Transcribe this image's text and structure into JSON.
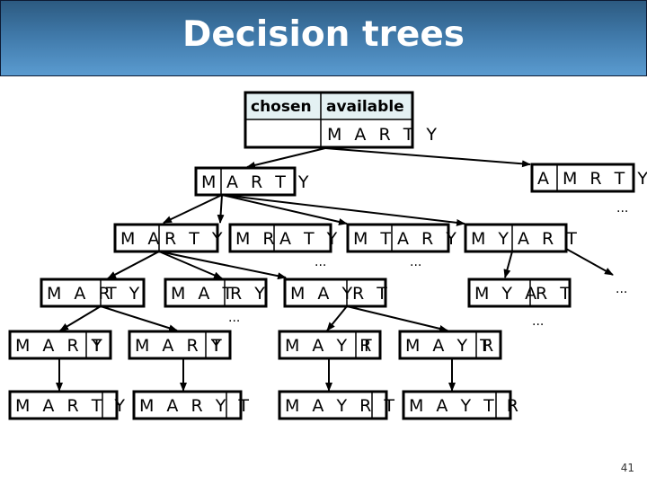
{
  "slide": {
    "title": "Decision trees",
    "page_number": "41"
  },
  "root_table": {
    "headers": [
      "chosen",
      "available"
    ],
    "chosen": "",
    "available": "M A R T Y"
  },
  "ellipsis": "...",
  "nodes": [
    {
      "id": "l1-m",
      "chosen": "M",
      "available": "A R T Y"
    },
    {
      "id": "l1-a",
      "chosen": "A",
      "available": "M R T Y"
    },
    {
      "id": "l2-ma",
      "chosen": "M A",
      "available": "R T Y"
    },
    {
      "id": "l2-mr",
      "chosen": "M R",
      "available": "A T Y"
    },
    {
      "id": "l2-mt",
      "chosen": "M T",
      "available": "A R Y"
    },
    {
      "id": "l2-my",
      "chosen": "M Y",
      "available": "A R T"
    },
    {
      "id": "l3-mar",
      "chosen": "M A R",
      "available": "T Y"
    },
    {
      "id": "l3-mat",
      "chosen": "M A T",
      "available": "R Y"
    },
    {
      "id": "l3-may",
      "chosen": "M A Y",
      "available": "R T"
    },
    {
      "id": "l3-mya",
      "chosen": "M Y A",
      "available": "R T"
    },
    {
      "id": "l4-mart",
      "chosen": "M A R T",
      "available": "Y"
    },
    {
      "id": "l4-mary",
      "chosen": "M A R Y",
      "available": "T"
    },
    {
      "id": "l4-mayr",
      "chosen": "M A Y R",
      "available": "T"
    },
    {
      "id": "l4-mayt",
      "chosen": "M A Y T",
      "available": "R"
    },
    {
      "id": "l5-marty",
      "chosen": "M A R T Y",
      "available": ""
    },
    {
      "id": "l5-maryt",
      "chosen": "M A R Y T",
      "available": ""
    },
    {
      "id": "l5-mayrt",
      "chosen": "M A Y R T",
      "available": ""
    },
    {
      "id": "l5-maytr",
      "chosen": "M A Y T R",
      "available": ""
    }
  ]
}
